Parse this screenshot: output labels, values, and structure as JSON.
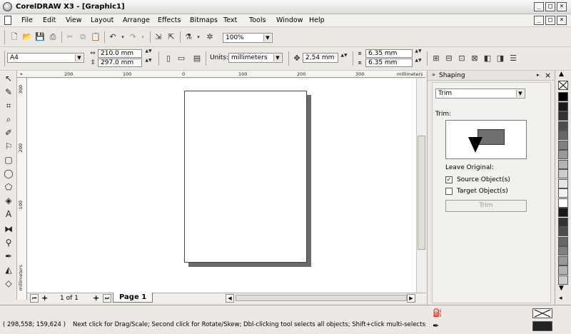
{
  "window": {
    "title": "CorelDRAW X3 - [Graphic1]",
    "min": "_",
    "restore": "□",
    "close": "×"
  },
  "menu": [
    "File",
    "Edit",
    "View",
    "Layout",
    "Arrange",
    "Effects",
    "Bitmaps",
    "Text",
    "Tools",
    "Window",
    "Help"
  ],
  "doc_controls": {
    "min": "_",
    "restore": "□",
    "close": "×"
  },
  "standard_toolbar": {
    "zoom": "100%"
  },
  "property_bar": {
    "paper_size": "A4",
    "width": "210.0 mm",
    "height": "297.0 mm",
    "units_label": "Units:",
    "units_value": "millimeters",
    "nudge": "2,54 mm",
    "dup_x": "6.35 mm",
    "dup_y": "6.35 mm"
  },
  "rulers": {
    "h_labels": [
      "200",
      "100",
      "0",
      "100",
      "200",
      "300"
    ],
    "h_units": "millimeters",
    "v_labels": [
      "300",
      "200",
      "100"
    ],
    "v_units": "millimeters"
  },
  "page_nav": {
    "counter": "1 of 1",
    "tab": "Page 1",
    "first": "⏮",
    "prev": "◀",
    "add": "+",
    "next": "▶",
    "last": "⏭"
  },
  "docker": {
    "title": "Shaping",
    "mode": "Trim",
    "section_label": "Trim:",
    "leave_original": "Leave Original:",
    "source_label": "Source Object(s)",
    "source_checked": true,
    "target_label": "Target Object(s)",
    "target_checked": false,
    "apply_button": "Trim"
  },
  "palette_colors": [
    "#000000",
    "#1a1a1a",
    "#333333",
    "#4d4d4d",
    "#666666",
    "#808080",
    "#999999",
    "#b3b3b3",
    "#cccccc",
    "#e6e6e6",
    "#f2f2f2",
    "#ffffff",
    "#1a1a1a",
    "#333333",
    "#4d4d4d",
    "#666666",
    "#808080",
    "#999999",
    "#b3b3b3",
    "#cccccc"
  ],
  "status": {
    "coords": "( 298,558; 159,624 )",
    "hint": "Next click for Drag/Scale; Second click for Rotate/Skew; Dbl-clicking tool selects all objects; Shift+click multi-selects; Alt+..."
  }
}
